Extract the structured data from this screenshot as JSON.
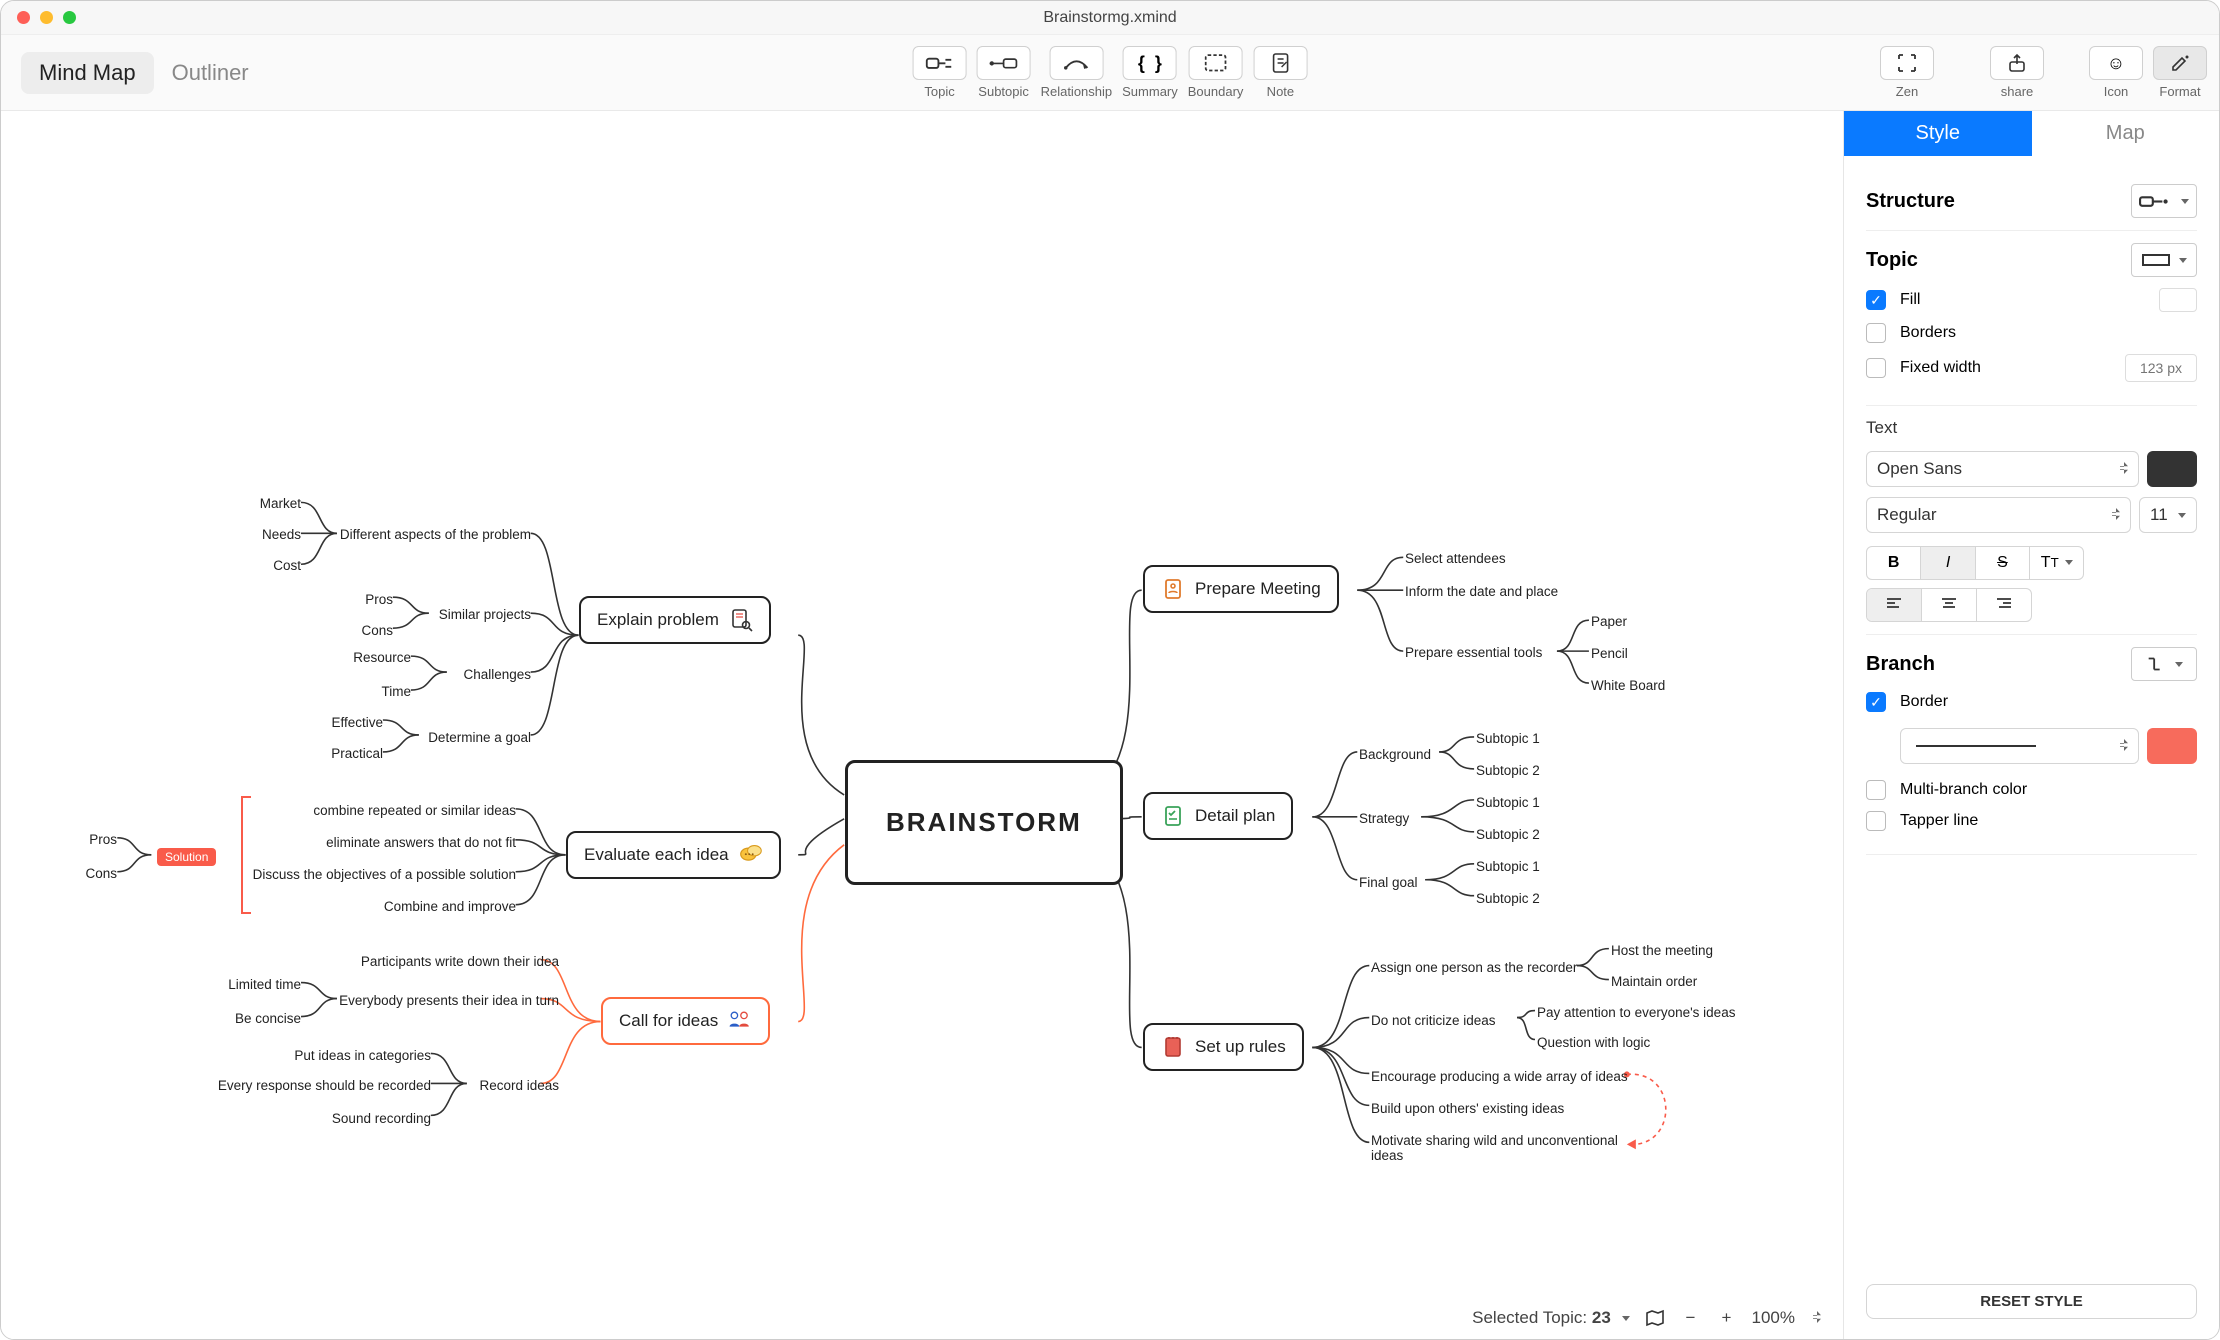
{
  "window": {
    "title": "Brainstormg.xmind"
  },
  "views": {
    "mindmap": "Mind Map",
    "outliner": "Outliner"
  },
  "tools": {
    "topic": "Topic",
    "subtopic": "Subtopic",
    "relationship": "Relationship",
    "summary": "Summary",
    "boundary": "Boundary",
    "note": "Note",
    "zen": "Zen",
    "share": "share",
    "icon": "Icon",
    "format": "Format"
  },
  "panel": {
    "tab_style": "Style",
    "tab_map": "Map",
    "structure": "Structure",
    "topic": "Topic",
    "fill": "Fill",
    "borders": "Borders",
    "fixed_width": "Fixed width",
    "fixed_width_ph": "123 px",
    "text": "Text",
    "font": "Open Sans",
    "weight": "Regular",
    "size": "11",
    "branch": "Branch",
    "border": "Border",
    "multi_branch": "Multi-branch color",
    "tapper": "Tapper line",
    "reset": "RESET STYLE"
  },
  "status": {
    "selected_label": "Selected Topic:",
    "selected_count": "23",
    "zoom": "100%"
  },
  "map": {
    "central": "BRAINSTORM",
    "right": {
      "prepare": {
        "title": "Prepare Meeting",
        "children": {
          "attendees": "Select attendees",
          "inform": "Inform the date and place",
          "tools": {
            "label": "Prepare essential tools",
            "items": {
              "paper": "Paper",
              "pencil": "Pencil",
              "whiteboard": "White Board"
            }
          }
        }
      },
      "detail": {
        "title": "Detail plan",
        "children": {
          "background": {
            "label": "Background",
            "a": "Subtopic 1",
            "b": "Subtopic 2"
          },
          "strategy": {
            "label": "Strategy",
            "a": "Subtopic 1",
            "b": "Subtopic 2"
          },
          "finalgoal": {
            "label": "Final goal",
            "a": "Subtopic 1",
            "b": "Subtopic 2"
          }
        }
      },
      "rules": {
        "title": "Set up rules",
        "children": {
          "recorder": {
            "label": "Assign one person as the recorder",
            "a": "Host the meeting",
            "b": "Maintain order"
          },
          "nocrit": {
            "label": "Do not criticize ideas",
            "a": "Pay attention to everyone's ideas",
            "b": "Question with logic"
          },
          "encourage": "Encourage producing a wide array of ideas",
          "build": "Build upon others' existing ideas",
          "motivate": "Motivate sharing wild and unconventional ideas"
        }
      }
    },
    "left": {
      "explain": {
        "title": "Explain problem",
        "children": {
          "aspects": {
            "label": "Different aspects of the problem",
            "a": "Market",
            "b": "Needs",
            "c": "Cost"
          },
          "similar": {
            "label": "Similar projects",
            "a": "Pros",
            "b": "Cons"
          },
          "challenges": {
            "label": "Challenges",
            "a": "Resource",
            "b": "Time"
          },
          "goal": {
            "label": "Determine a goal",
            "a": "Effective",
            "b": "Practical"
          }
        }
      },
      "evaluate": {
        "title": "Evaluate each idea",
        "children": {
          "combine": "combine repeated or similar ideas",
          "eliminate": "eliminate answers that do not fit",
          "discuss": "Discuss the objectives of a possible solution",
          "improve": "Combine and improve"
        },
        "solution": {
          "tag": "Solution",
          "a": "Pros",
          "b": "Cons"
        }
      },
      "call": {
        "title": "Call for ideas",
        "children": {
          "write": "Participants write down their idea",
          "present": {
            "label": "Everybody presents their idea in turn",
            "a": "Limited time",
            "b": "Be concise"
          },
          "record": {
            "label": "Record ideas",
            "a": "Put ideas in categories",
            "b": "Every response should be recorded",
            "c": "Sound recording"
          }
        }
      }
    }
  },
  "colors": {
    "accent": "#0a7aff",
    "orange": "#ff6a3d",
    "red": "#f95b4a",
    "dark": "#333333",
    "branch_chip": "#f76b5c"
  }
}
